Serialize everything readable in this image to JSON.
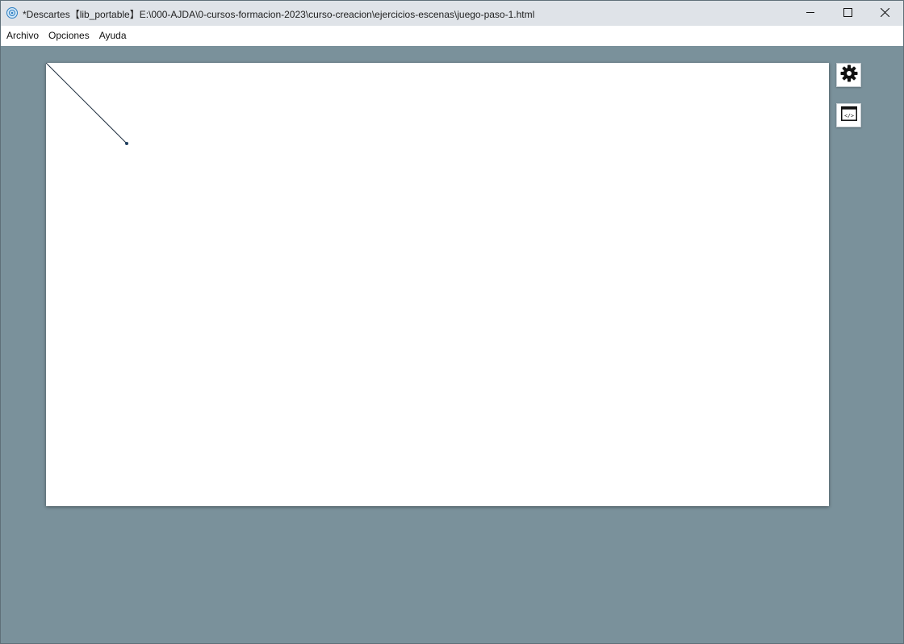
{
  "window": {
    "title": "*Descartes【lib_portable】E:\\000-AJDA\\0-cursos-formacion-2023\\curso-creacion\\ejercicios-escenas\\juego-paso-1.html",
    "icons": {
      "app": "descartes-app-icon",
      "minimize": "minimize-icon",
      "maximize": "maximize-icon",
      "close": "close-icon"
    }
  },
  "menu": {
    "items": [
      {
        "label": "Archivo"
      },
      {
        "label": "Opciones"
      },
      {
        "label": "Ayuda"
      }
    ]
  },
  "sidebar": {
    "config_icon": "gear-icon",
    "code_icon": "code-window-icon"
  },
  "colors": {
    "background": "#7a919b",
    "titlebar": "#dfe3e8",
    "canvas": "#ffffff",
    "line": "#1f2f3f"
  }
}
